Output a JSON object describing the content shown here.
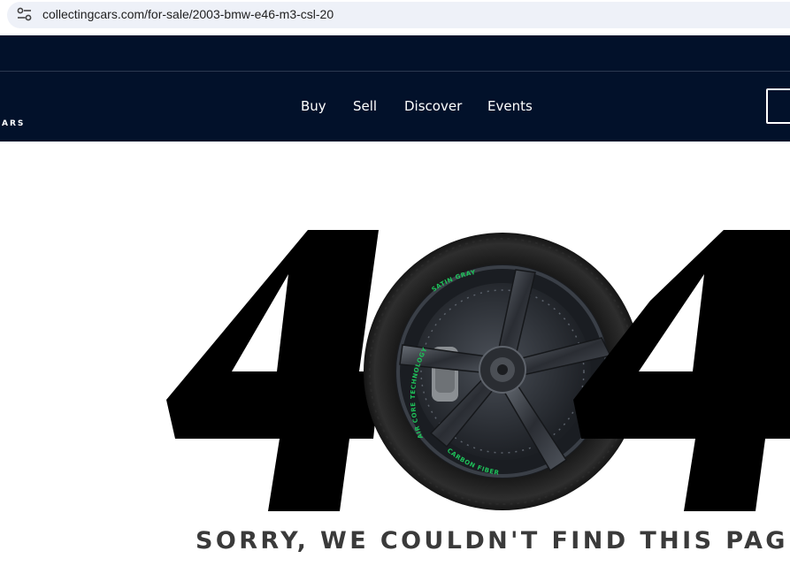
{
  "browser": {
    "url": "collectingcars.com/for-sale/2003-bmw-e46-m3-csl-20",
    "site_info_icon": "tune-icon"
  },
  "header": {
    "logo_fragment": "ARS",
    "nav": [
      {
        "label": "Buy"
      },
      {
        "label": "Sell"
      },
      {
        "label": "Discover"
      },
      {
        "label": "Events"
      }
    ],
    "colors": {
      "background": "#02112a",
      "text": "#ffffff"
    }
  },
  "error_page": {
    "code_glyph": "4",
    "wheel_text": [
      "AIR CORE TECHNOLOGY",
      "CARBON FIBER",
      "SATIN GRAY"
    ],
    "message": "SORRY, WE COULDN'T FIND THIS PAGE.",
    "colors": {
      "digit": "#000000",
      "message": "#3a3a3a",
      "wheel_accent": "#1ec25a"
    }
  }
}
